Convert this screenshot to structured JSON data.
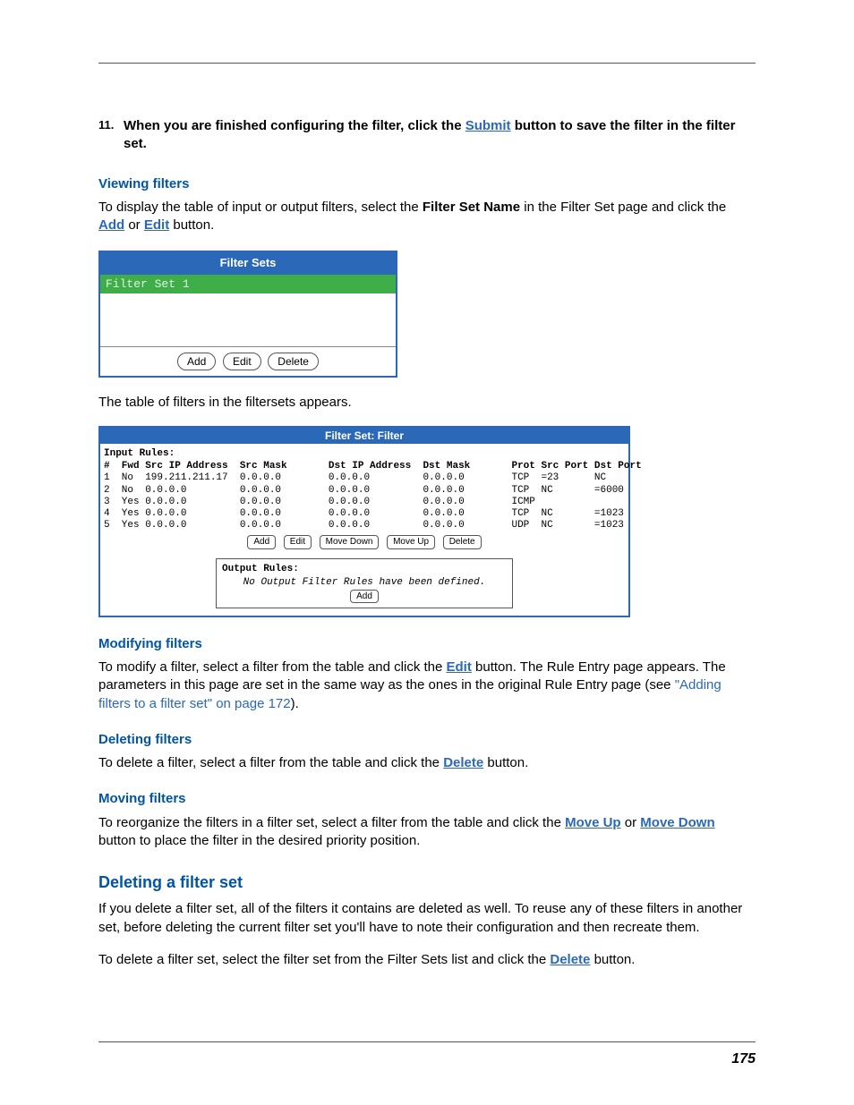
{
  "step": {
    "num": "11.",
    "text_a": "When you are finished configuring the filter, click the ",
    "link": "Submit",
    "text_b": " button to save the filter in the filter set."
  },
  "viewing": {
    "head": "Viewing filters",
    "p_a": "To display the table of input or output filters, select the ",
    "p_bold": "Filter Set Name",
    "p_b": " in the Filter Set page and click the ",
    "link1": "Add",
    "p_or": " or ",
    "link2": "Edit",
    "p_c": " button."
  },
  "filter_sets_box": {
    "title": "Filter Sets",
    "selected": "Filter Set 1",
    "btn_add": "Add",
    "btn_edit": "Edit",
    "btn_delete": "Delete"
  },
  "after_box": "The table of filters in the filtersets appears.",
  "filter_filter_box": {
    "title": "Filter Set: Filter",
    "input_rules_label": "Input Rules:",
    "headers": "#  Fwd Src IP Address  Src Mask       Dst IP Address  Dst Mask       Prot Src Port Dst Port",
    "rows": [
      "1  No  199.211.211.17  0.0.0.0        0.0.0.0         0.0.0.0        TCP  =23      NC",
      "2  No  0.0.0.0         0.0.0.0        0.0.0.0         0.0.0.0        TCP  NC       =6000",
      "3  Yes 0.0.0.0         0.0.0.0        0.0.0.0         0.0.0.0        ICMP",
      "4  Yes 0.0.0.0         0.0.0.0        0.0.0.0         0.0.0.0        TCP  NC       =1023",
      "5  Yes 0.0.0.0         0.0.0.0        0.0.0.0         0.0.0.0        UDP  NC       =1023"
    ],
    "btn_add": "Add",
    "btn_edit": "Edit",
    "btn_movedown": "Move Down",
    "btn_moveup": "Move Up",
    "btn_delete": "Delete",
    "output_rules_label": "Output Rules:",
    "output_rules_msg": "No Output Filter Rules have been defined.",
    "btn_add2": "Add"
  },
  "modifying": {
    "head": "Modifying filters",
    "p_a": "To modify a filter, select a filter from the table and click the ",
    "link": "Edit",
    "p_b": " button. The Rule Entry page appears. The parameters in this page are set in the same way as the ones in the original Rule Entry page (see ",
    "xref": "\"Adding filters to a filter set\" on page 172",
    "p_c": ")."
  },
  "deleting": {
    "head": "Deleting filters",
    "p_a": "To delete a filter, select a filter from the table and click the ",
    "link": "Delete",
    "p_b": " button."
  },
  "moving": {
    "head": "Moving filters",
    "p_a": "To reorganize the filters in a filter set, select a filter from the table and click the ",
    "link1": "Move Up",
    "p_or": " or ",
    "link2": "Move Down",
    "p_b": " button to place the filter in the desired priority position."
  },
  "deleting_set": {
    "head": "Deleting a filter set",
    "p1": "If you delete a filter set, all of the filters it contains are deleted as well. To reuse any of these filters in another set, before deleting the current filter set you'll have to note their configuration and then recreate them.",
    "p2_a": "To delete a filter set, select the filter set from the Filter Sets list and click the ",
    "link": "Delete",
    "p2_b": " button."
  },
  "page_number": "175"
}
